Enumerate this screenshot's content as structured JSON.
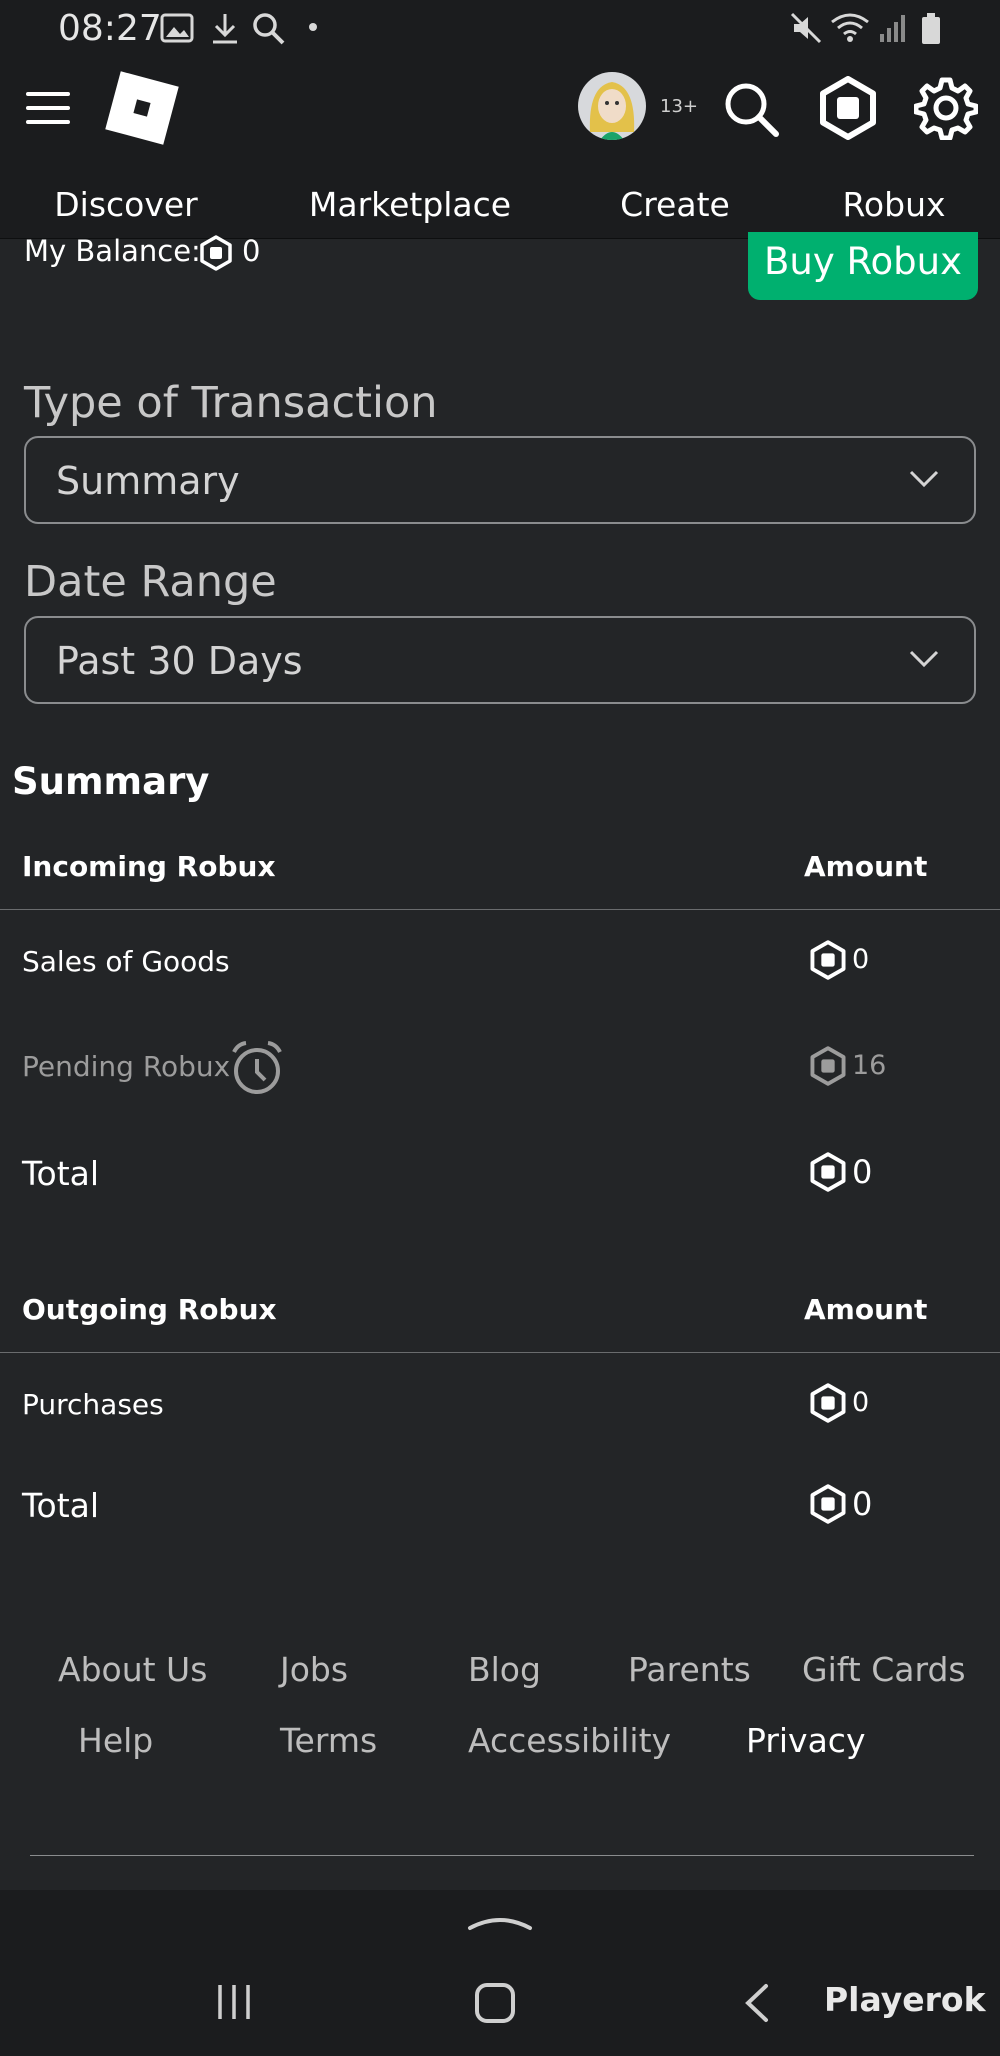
{
  "status_bar": {
    "time": "08:27",
    "icons": [
      "gallery-icon",
      "download-icon",
      "search-icon",
      "dot-icon",
      "mute-icon",
      "wifi-icon",
      "signal-icon",
      "battery-icon"
    ]
  },
  "header": {
    "age_badge": "13+",
    "icons": [
      "menu-icon",
      "roblox-logo",
      "avatar",
      "search-icon",
      "robux-icon",
      "settings-icon"
    ]
  },
  "nav": {
    "items": [
      "Discover",
      "Marketplace",
      "Create",
      "Robux"
    ]
  },
  "balance": {
    "label": "My Balance:",
    "value": "0",
    "buy_button": "Buy Robux"
  },
  "filters": {
    "type_label": "Type of Transaction",
    "type_value": "Summary",
    "date_label": "Date Range",
    "date_value": "Past 30 Days"
  },
  "summary": {
    "title": "Summary",
    "incoming": {
      "header": "Incoming Robux",
      "amount_header": "Amount",
      "rows": [
        {
          "label": "Sales of Goods",
          "amount": "0"
        },
        {
          "label": "Pending Robux",
          "amount": "16"
        }
      ],
      "total_label": "Total",
      "total_amount": "0"
    },
    "outgoing": {
      "header": "Outgoing Robux",
      "amount_header": "Amount",
      "rows": [
        {
          "label": "Purchases",
          "amount": "0"
        }
      ],
      "total_label": "Total",
      "total_amount": "0"
    }
  },
  "footer": {
    "row1": [
      "About Us",
      "Jobs",
      "Blog",
      "Parents",
      "Gift Cards"
    ],
    "row2": [
      "Help",
      "Terms",
      "Accessibility",
      "Privacy"
    ]
  },
  "watermark": "Playerok",
  "colors": {
    "background": "#232527",
    "header": "#1b1c1e",
    "accent_green": "#00b06f"
  }
}
